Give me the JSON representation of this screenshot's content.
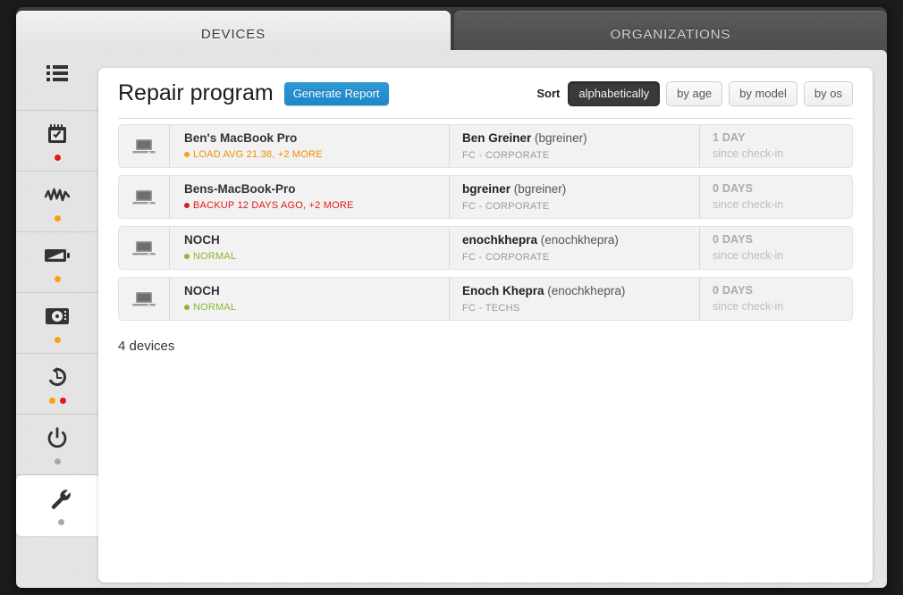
{
  "window": {
    "tabs": [
      {
        "label": "DEVICES",
        "active": true
      },
      {
        "label": "ORGANIZATIONS",
        "active": false
      }
    ]
  },
  "sidebar": {
    "items": [
      {
        "name": "list",
        "icon": "list-icon",
        "dots": []
      },
      {
        "name": "tasks",
        "icon": "checklist-calendar-icon",
        "dots": [
          "red"
        ]
      },
      {
        "name": "activity",
        "icon": "activity-pulse-icon",
        "dots": [
          "orange"
        ]
      },
      {
        "name": "battery",
        "icon": "battery-icon",
        "dots": [
          "orange"
        ]
      },
      {
        "name": "storage",
        "icon": "hard-drive-icon",
        "dots": [
          "orange"
        ]
      },
      {
        "name": "history",
        "icon": "clock-history-icon",
        "dots": [
          "orange",
          "red"
        ]
      },
      {
        "name": "power",
        "icon": "power-icon",
        "dots": [
          "gray"
        ]
      },
      {
        "name": "repair",
        "icon": "wrench-icon",
        "dots": [
          "gray"
        ],
        "active": true
      }
    ]
  },
  "main": {
    "title": "Repair program",
    "generate_report_label": "Generate Report",
    "sort": {
      "label": "Sort",
      "options": [
        {
          "label": "alphabetically",
          "selected": true
        },
        {
          "label": "by age",
          "selected": false
        },
        {
          "label": "by model",
          "selected": false
        },
        {
          "label": "by os",
          "selected": false
        }
      ]
    },
    "devices": [
      {
        "icon": "laptop-icon",
        "name": "Ben's MacBook Pro",
        "status_text": "LOAD AVG 21.38, +2 MORE",
        "status_color": "orange",
        "user_name": "Ben Greiner",
        "user_handle": "(bgreiner)",
        "org": "FC - CORPORATE",
        "since_value": "1 DAY",
        "since_label": "since check-in"
      },
      {
        "icon": "laptop-icon",
        "name": "Bens-MacBook-Pro",
        "status_text": "BACKUP 12 DAYS AGO, +2 MORE",
        "status_color": "red",
        "user_name": "bgreiner",
        "user_handle": "(bgreiner)",
        "org": "FC - CORPORATE",
        "since_value": "0 DAYS",
        "since_label": "since check-in"
      },
      {
        "icon": "laptop-icon",
        "name": "NOCH",
        "status_text": "NORMAL",
        "status_color": "green",
        "user_name": "enochkhepra",
        "user_handle": "(enochkhepra)",
        "org": "FC - CORPORATE",
        "since_value": "0 DAYS",
        "since_label": "since check-in"
      },
      {
        "icon": "laptop-icon",
        "name": "NOCH",
        "status_text": "NORMAL",
        "status_color": "green",
        "user_name": "Enoch Khepra",
        "user_handle": "(enochkhepra)",
        "org": "FC - TECHS",
        "since_value": "0 DAYS",
        "since_label": "since check-in"
      }
    ],
    "device_count": "4 devices"
  },
  "colors": {
    "accent_blue": "#1b87c7",
    "status_orange": "#f5a311",
    "status_red": "#e01b1b",
    "status_green": "#8cb832",
    "selected_dark": "#3a3a3a"
  }
}
